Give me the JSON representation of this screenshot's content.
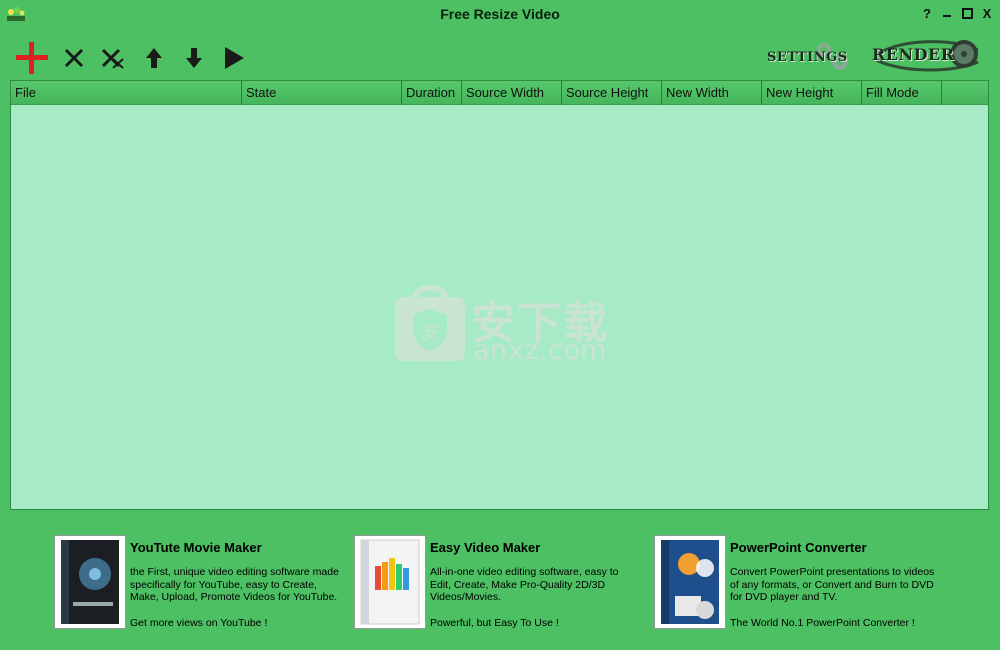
{
  "window": {
    "title": "Free Resize Video",
    "controls": {
      "help": "?",
      "minimize": "▬",
      "maximize": "□",
      "close": "X"
    }
  },
  "toolbar": {
    "buttons": [
      {
        "name": "add-file-button",
        "icon": "plus-icon"
      },
      {
        "name": "remove-file-button",
        "icon": "x-icon"
      },
      {
        "name": "clear-all-button",
        "icon": "double-x-icon"
      },
      {
        "name": "move-up-button",
        "icon": "arrow-up-icon"
      },
      {
        "name": "move-down-button",
        "icon": "arrow-down-icon"
      },
      {
        "name": "play-button",
        "icon": "play-icon"
      }
    ],
    "settings_label": "Settings",
    "render_label": "Render"
  },
  "file_list": {
    "columns": [
      "File",
      "State",
      "Duration",
      "Source Width",
      "Source Height",
      "New Width",
      "New Height",
      "Fill Mode"
    ],
    "rows": []
  },
  "watermark": {
    "cn": "安下载",
    "en": "anxz.com"
  },
  "promos": [
    {
      "title": "YouTute Movie Maker",
      "desc": "the First, unique video editing software made specifically for YouTube, easy to Create, Make, Upload, Promote Videos for YouTube.",
      "tagline": "Get more views on YouTube !"
    },
    {
      "title": "Easy Video Maker",
      "desc": "All-in-one video editing software, easy to Edit, Create, Make Pro-Quality 2D/3D Videos/Movies.",
      "tagline": "Powerful, but Easy To Use !"
    },
    {
      "title": "PowerPoint Converter",
      "desc": "Convert PowerPoint presentations to videos of any formats, or Convert and Burn to DVD for DVD player and TV.",
      "tagline": "The World No.1 PowerPoint Converter !"
    }
  ],
  "colors": {
    "background": "#4cc062",
    "list_background": "#a7eac6",
    "header": "#4dbf62",
    "add_icon": "#e02020"
  }
}
